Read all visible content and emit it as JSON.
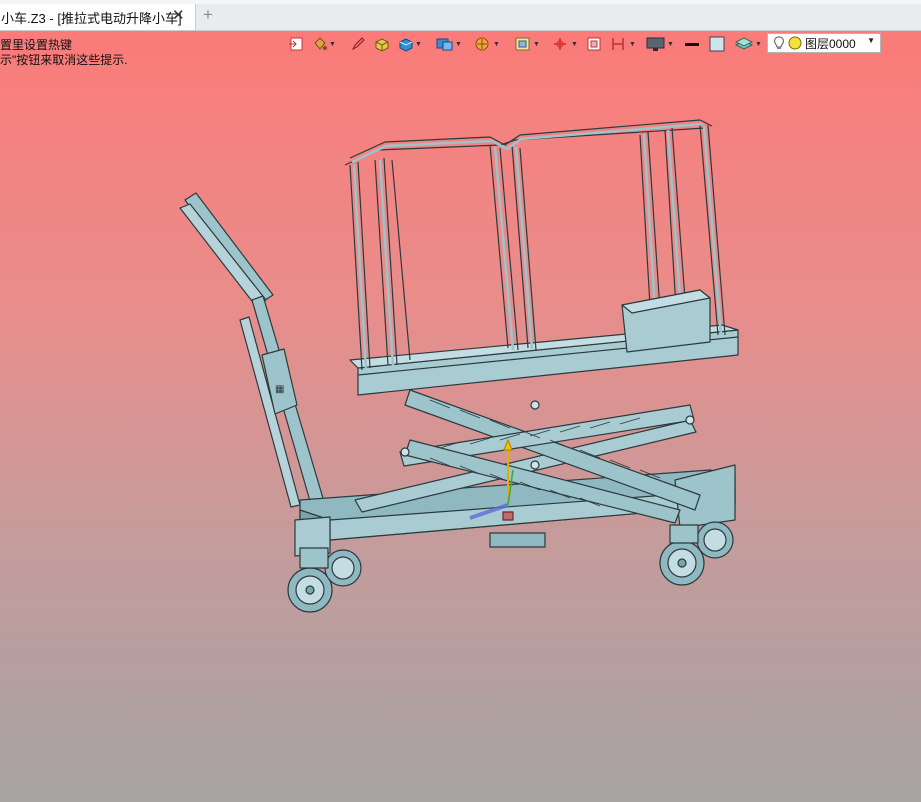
{
  "tab": {
    "title": "小车.Z3 - [推拉式电动升降小车]",
    "close_glyph": "✕",
    "new_tab_glyph": "+"
  },
  "hints": {
    "line1": "置里设置热键",
    "line2": "示\"按钮来取消这些提示."
  },
  "toolbar": {
    "icons": [
      "exit-sketch-icon",
      "paint-bucket-icon",
      "pencil-icon",
      "shaded-box-icon",
      "solid-box-icon",
      "display-mode-icon",
      "section-view-icon",
      "view-frame-icon",
      "axis-triad-icon",
      "zoom-area-icon",
      "dimension-icon",
      "monitor-icon",
      "line-color-icon",
      "background-color-icon",
      "layers-stack-icon"
    ],
    "layer_label": "图层0000"
  },
  "colors": {
    "viewport_top": "#fb7b79",
    "viewport_bottom": "#a7a4a4",
    "model_fill": "#9dc3cb",
    "model_stroke": "#2b3a3e"
  }
}
